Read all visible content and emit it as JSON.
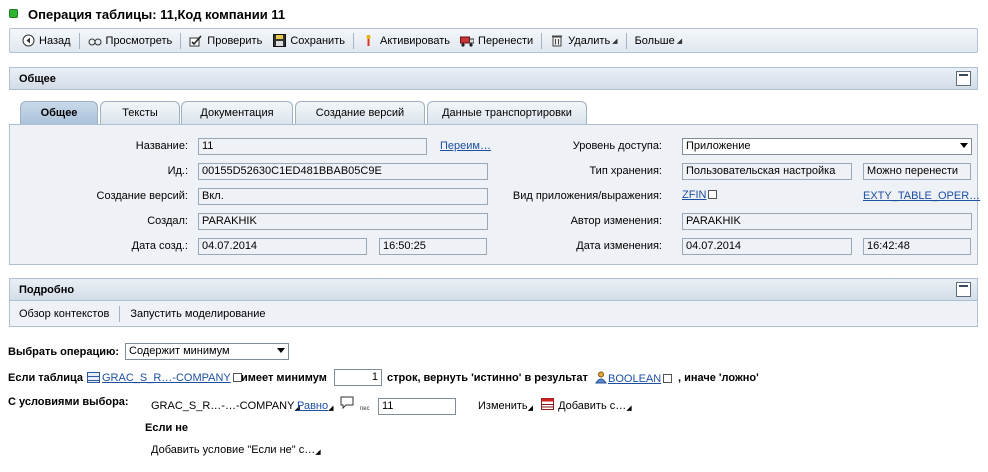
{
  "title": "Операция таблицы: 11,Код компании 11",
  "toolbar": {
    "back": "Назад",
    "view": "Просмотреть",
    "check": "Проверить",
    "save": "Сохранить",
    "activate": "Активировать",
    "transport": "Перенести",
    "delete": "Удалить",
    "more": "Больше"
  },
  "general_section": {
    "title": "Общее"
  },
  "tabs": [
    "Общее",
    "Тексты",
    "Документация",
    "Создание версий",
    "Данные транспортировки"
  ],
  "general": {
    "name_label": "Название:",
    "name_value": "11",
    "rename_link": "Переим…",
    "id_label": "Ид.:",
    "id_value": "00155D52630C1ED481BBAB05C9E",
    "versioning_label": "Создание версий:",
    "versioning_value": "Вкл.",
    "created_by_label": "Создал:",
    "created_by_value": "PARAKHIK",
    "created_on_label": "Дата созд.:",
    "created_on_date": "04.07.2014",
    "created_on_time": "16:50:25",
    "access_level_label": "Уровень доступа:",
    "access_level_value": "Приложение",
    "storage_type_label": "Тип хранения:",
    "storage_type_value": "Пользовательская настройка",
    "storage_transport_value": "Можно перенести",
    "app_label": "Вид приложения/выражения:",
    "app_value": "ZFIN",
    "app_type_link": "EXTY_TABLE_OPER…",
    "changed_by_label": "Автор изменения:",
    "changed_by_value": "PARAKHIK",
    "changed_on_label": "Дата изменения:",
    "changed_on_date": "04.07.2014",
    "changed_on_time": "16:42:48"
  },
  "details_section": {
    "title": "Подробно",
    "context_overview": "Обзор контекстов",
    "run_simulation": "Запустить моделирование"
  },
  "operation": {
    "select_label": "Выбрать операцию:",
    "select_value": "Содержит минимум",
    "if_table": "Если таблица",
    "table_link": "GRAC_S_R…-COMPANY",
    "has_min": "имеет минимум",
    "min_value": "1",
    "rows_return": "строк, вернуть 'истинно' в результат",
    "result_link": "BOOLEAN",
    "else_false": ", иначе 'ложно'",
    "with_conditions": "С условиями выбора:",
    "cond_field": "GRAC_S_R…-…-COMPANY",
    "cond_op": "Равно",
    "cond_value": "11",
    "change": "Изменить",
    "add": "Добавить с…",
    "if_not": "Если не",
    "add_if_not": "Добавить условие \"Если не\" с…"
  },
  "colors": {
    "accent": "#1d4fa0",
    "status_green": "#2fb42f",
    "panel": "#eef2f6"
  }
}
